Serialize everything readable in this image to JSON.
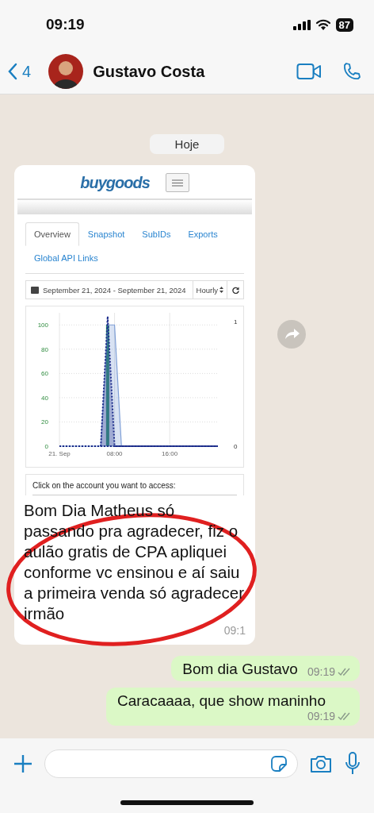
{
  "status_bar": {
    "time": "09:19",
    "battery": "87"
  },
  "header": {
    "back_count": "4",
    "contact_name": "Gustavo Costa"
  },
  "date_chip": "Hoje",
  "messages": [
    {
      "kind": "image",
      "annotated": true,
      "text": "Bom Dia Matheus só passando pra agradecer, fiz o aulão gratis de CPA apliquei conforme vc ensinou e aí saiu a primeira venda só agradecer irmão",
      "time": "09:1",
      "embedded": {
        "logo": "buygoods",
        "tabs": [
          {
            "label": "Overview",
            "selected": true
          },
          {
            "label": "Snapshot",
            "selected": false
          },
          {
            "label": "SubIDs",
            "selected": false
          },
          {
            "label": "Exports",
            "selected": false
          },
          {
            "label": "Global API Links",
            "selected": false
          }
        ],
        "date_range": "September 21, 2024 - September 21, 2024",
        "interval": "Hourly",
        "right_axis_labels": [
          "1",
          "0"
        ],
        "account_prompt": "Click on the account you want to access:",
        "chart_data": {
          "type": "area",
          "grid": true,
          "x": [
            0,
            1,
            2,
            3,
            4,
            5,
            6,
            7,
            8,
            9,
            10,
            11,
            12,
            13,
            14,
            15,
            16,
            17,
            18,
            19,
            20,
            21,
            22,
            23
          ],
          "xlim": [
            0,
            23
          ],
          "ylim": [
            0,
            110
          ],
          "yticks": [
            0,
            20,
            40,
            60,
            80,
            100
          ],
          "xticks": [
            {
              "value": 0,
              "label": "21. Sep"
            },
            {
              "value": 8,
              "label": "08:00"
            },
            {
              "value": 16,
              "label": "16:00"
            }
          ],
          "ref_lines": [
            {
              "axis": "x",
              "value": 7,
              "color": "#1f9a5a"
            }
          ],
          "series": [
            {
              "color": "#7f9fd6",
              "line_style": "solid",
              "values": [
                0,
                0,
                0,
                0,
                0,
                0,
                0,
                100,
                100,
                0,
                0,
                0,
                0,
                0,
                0,
                0,
                0,
                0,
                0,
                0,
                0,
                0,
                0,
                0
              ]
            },
            {
              "color": "#1a2a8a",
              "line_style": "dotted",
              "values": [
                0,
                0,
                0,
                0,
                0,
                0,
                0,
                107,
                0,
                0,
                0,
                0,
                0,
                0,
                0,
                0,
                0,
                0,
                0,
                0,
                0,
                0,
                0,
                0
              ]
            }
          ]
        }
      }
    },
    {
      "kind": "text",
      "text": "Bom dia Gustavo",
      "time": "09:19",
      "read": false
    },
    {
      "kind": "text",
      "text": "Caracaaaa, que show maninho",
      "time": "09:19",
      "read": false
    }
  ]
}
